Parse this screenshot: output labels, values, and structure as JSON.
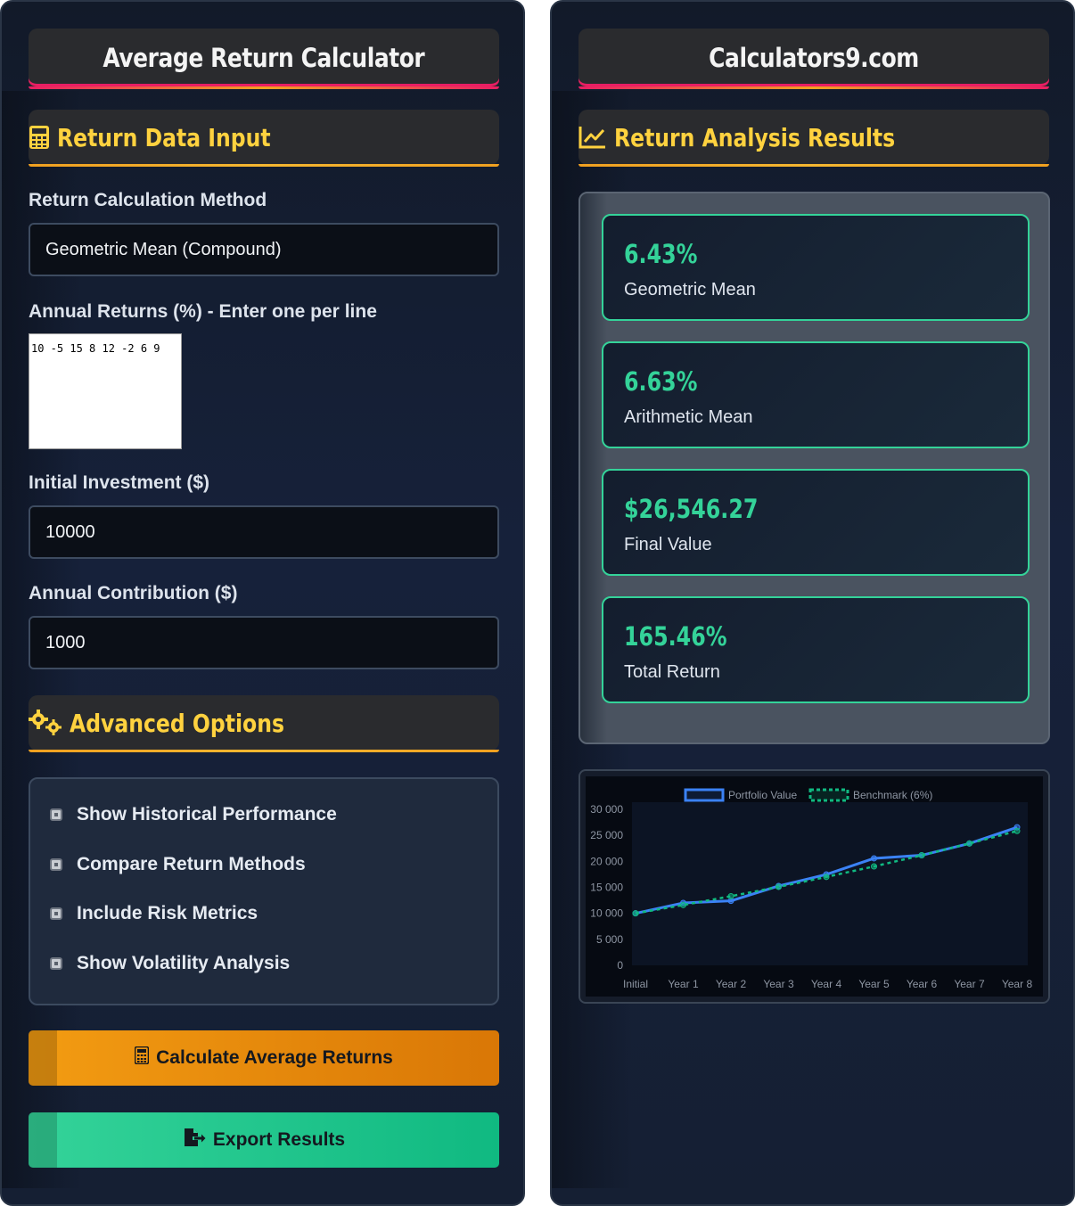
{
  "calculator": {
    "title": "Average Return Calculator",
    "input_section": {
      "title": "Return Data Input",
      "icon": "calculator-icon"
    },
    "method": {
      "label": "Return Calculation Method",
      "value": "Geometric Mean (Compound)"
    },
    "returns": {
      "label": "Annual Returns (%) - Enter one per line",
      "value": "10 -5 15 8 12 -2 6 9"
    },
    "initial": {
      "label": "Initial Investment ($)",
      "value": "10000"
    },
    "contribution": {
      "label": "Annual Contribution ($)",
      "value": "1000"
    },
    "advanced": {
      "title": "Advanced Options",
      "icon": "gears-icon",
      "options": [
        {
          "label": "Show Historical Performance"
        },
        {
          "label": "Compare Return Methods"
        },
        {
          "label": "Include Risk Metrics"
        },
        {
          "label": "Show Volatility Analysis"
        }
      ]
    },
    "calculate_button": "Calculate Average Returns",
    "export_button": "Export Results",
    "colors": {
      "accent_orange": "#f39c12",
      "accent_green": "#34d399",
      "heading_yellow": "#ffd23f"
    }
  },
  "results": {
    "site_title": "Calculators9.com",
    "section": {
      "title": "Return Analysis Results",
      "icon": "line-chart-icon"
    },
    "cards": [
      {
        "value": "6.43%",
        "label": "Geometric Mean"
      },
      {
        "value": "6.63%",
        "label": "Arithmetic Mean"
      },
      {
        "value": "$26,546.27",
        "label": "Final Value"
      },
      {
        "value": "165.46%",
        "label": "Total Return"
      }
    ]
  },
  "chart_data": {
    "type": "line",
    "categories": [
      "Initial",
      "Year 1",
      "Year 2",
      "Year 3",
      "Year 4",
      "Year 5",
      "Year 6",
      "Year 7",
      "Year 8"
    ],
    "series": [
      {
        "name": "Portfolio Value",
        "color": "#3b82f6",
        "style": "solid",
        "values": [
          10000,
          12000,
          12400,
          15260,
          17480,
          20578,
          21166,
          23436,
          26546
        ]
      },
      {
        "name": "Benchmark (6%)",
        "color": "#10b981",
        "style": "dashed",
        "values": [
          10000,
          11600,
          13296,
          15094,
          17000,
          19020,
          21161,
          23431,
          25837
        ]
      }
    ],
    "yticks": [
      "0",
      "5 000",
      "10 000",
      "15 000",
      "20 000",
      "25 000",
      "30 000"
    ],
    "ylim": [
      0,
      30000
    ],
    "grid": false,
    "legend_position": "top"
  }
}
